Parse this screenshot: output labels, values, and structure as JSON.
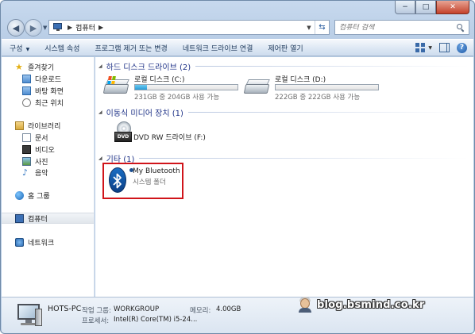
{
  "window": {
    "caption_buttons": {
      "minimize": "−",
      "maximize": "□",
      "close": "✕"
    }
  },
  "address": {
    "breadcrumb": "컴퓨터",
    "separator": "▶"
  },
  "search": {
    "placeholder": "컴퓨터 검색"
  },
  "commandbar": {
    "items": [
      "구성",
      "시스템 속성",
      "프로그램 제거 또는 변경",
      "네트워크 드라이브 연결",
      "제어판 열기"
    ]
  },
  "sidebar": {
    "favorites": {
      "label": "즐겨찾기",
      "items": [
        "다운로드",
        "바탕 화면",
        "최근 위치"
      ]
    },
    "libraries": {
      "label": "라이브러리",
      "items": [
        "문서",
        "비디오",
        "사진",
        "음악"
      ]
    },
    "homegroup": "홈 그룹",
    "computer": "컴퓨터",
    "network": "네트워크"
  },
  "groups": {
    "hard_disks": {
      "title": "하드 디스크 드라이브 (2)",
      "drives": [
        {
          "name": "로컬 디스크 (C:)",
          "free_text": "231GB 중 204GB 사용 가능",
          "used_fraction": 0.117
        },
        {
          "name": "로컬 디스크 (D:)",
          "free_text": "222GB 중 222GB 사용 가능",
          "used_fraction": 0.0
        }
      ]
    },
    "removable": {
      "title": "이동식 미디어 장치 (1)",
      "dvd": {
        "name": "DVD RW 드라이브 (F:)",
        "badge": "DVD"
      }
    },
    "other": {
      "title": "기타 (1)",
      "bluetooth": {
        "name": "My Bluetooth",
        "subtitle": "시스템 폴더"
      }
    }
  },
  "details": {
    "pc_name": "HOTS-PC",
    "workgroup_label": "작업 그룹:",
    "workgroup_value": "WORKGROUP",
    "memory_label": "메모리:",
    "memory_value": "4.00GB",
    "processor_label": "프로세서:",
    "processor_value": "Intel(R) Core(TM) i5-24..."
  },
  "watermark": "blog.bsmind.co.kr",
  "colors": {
    "accent": "#1e3287",
    "highlight_border": "#d0141a",
    "capacity_bar": "#2a9bd6"
  }
}
